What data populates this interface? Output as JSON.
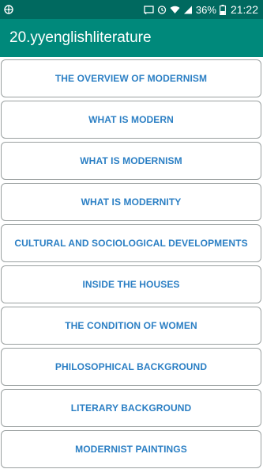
{
  "status_bar": {
    "battery_percent": "36%",
    "time": "21:22",
    "icons": [
      "app-notification-icon",
      "screencast-icon",
      "alarm-icon",
      "wifi-icon",
      "signal-icon",
      "battery-icon"
    ]
  },
  "app_bar": {
    "title": "20.yyenglishliterature"
  },
  "menu": {
    "items": [
      {
        "label": "THE OVERVIEW OF MODERNISM"
      },
      {
        "label": "WHAT IS MODERN"
      },
      {
        "label": "WHAT IS MODERNISM"
      },
      {
        "label": "WHAT IS MODERNITY"
      },
      {
        "label": "CULTURAL AND SOCIOLOGICAL DEVELOPMENTS"
      },
      {
        "label": "INSIDE THE HOUSES"
      },
      {
        "label": "THE CONDITION OF WOMEN"
      },
      {
        "label": "PHILOSOPHICAL BACKGROUND"
      },
      {
        "label": "LITERARY BACKGROUND"
      },
      {
        "label": "MODERNIST PAINTINGS"
      }
    ]
  },
  "colors": {
    "status_bar": "#00695f",
    "app_bar": "#00897b",
    "button_text": "#2b7fc4",
    "button_border": "#9aa0a0"
  }
}
